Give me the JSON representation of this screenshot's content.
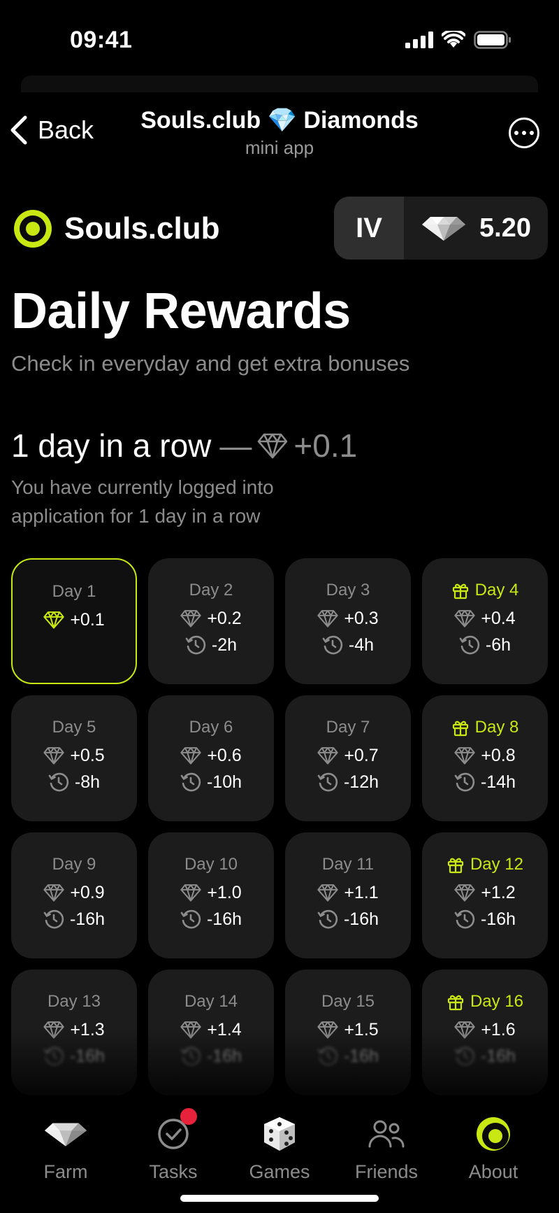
{
  "status_bar": {
    "time": "09:41"
  },
  "nav": {
    "back_label": "Back",
    "title": "Souls.club 💎 Diamonds",
    "subtitle": "mini app"
  },
  "brand": {
    "name": "Souls.club",
    "level": "IV",
    "balance": "5.20"
  },
  "header": {
    "title": "Daily Rewards",
    "subtitle": "Check in everyday and get extra bonuses"
  },
  "streak": {
    "text": "1 day in a row",
    "dash": "—",
    "bonus": "+0.1",
    "description": "You have currently logged into application for 1 day in a row"
  },
  "days": [
    {
      "label": "Day 1",
      "reward": "+0.1",
      "wait": "",
      "gift": false,
      "active": true
    },
    {
      "label": "Day 2",
      "reward": "+0.2",
      "wait": "-2h",
      "gift": false
    },
    {
      "label": "Day 3",
      "reward": "+0.3",
      "wait": "-4h",
      "gift": false
    },
    {
      "label": "Day 4",
      "reward": "+0.4",
      "wait": "-6h",
      "gift": true
    },
    {
      "label": "Day 5",
      "reward": "+0.5",
      "wait": "-8h",
      "gift": false
    },
    {
      "label": "Day 6",
      "reward": "+0.6",
      "wait": "-10h",
      "gift": false
    },
    {
      "label": "Day 7",
      "reward": "+0.7",
      "wait": "-12h",
      "gift": false
    },
    {
      "label": "Day 8",
      "reward": "+0.8",
      "wait": "-14h",
      "gift": true
    },
    {
      "label": "Day 9",
      "reward": "+0.9",
      "wait": "-16h",
      "gift": false
    },
    {
      "label": "Day 10",
      "reward": "+1.0",
      "wait": "-16h",
      "gift": false
    },
    {
      "label": "Day 11",
      "reward": "+1.1",
      "wait": "-16h",
      "gift": false
    },
    {
      "label": "Day 12",
      "reward": "+1.2",
      "wait": "-16h",
      "gift": true
    },
    {
      "label": "Day 13",
      "reward": "+1.3",
      "wait": "-16h",
      "gift": false
    },
    {
      "label": "Day 14",
      "reward": "+1.4",
      "wait": "-16h",
      "gift": false
    },
    {
      "label": "Day 15",
      "reward": "+1.5",
      "wait": "-16h",
      "gift": false
    },
    {
      "label": "Day 16",
      "reward": "+1.6",
      "wait": "-16h",
      "gift": true
    }
  ],
  "tabs": [
    {
      "label": "Farm",
      "icon": "diamond-icon"
    },
    {
      "label": "Tasks",
      "icon": "check-circle-icon",
      "badge": true
    },
    {
      "label": "Games",
      "icon": "dice-icon"
    },
    {
      "label": "Friends",
      "icon": "friends-icon"
    },
    {
      "label": "About",
      "icon": "souls-logo-icon"
    }
  ],
  "colors": {
    "accent": "#c9e712",
    "card": "#1c1c1c",
    "muted": "#8c8c8c",
    "badge": "#e8223a"
  }
}
